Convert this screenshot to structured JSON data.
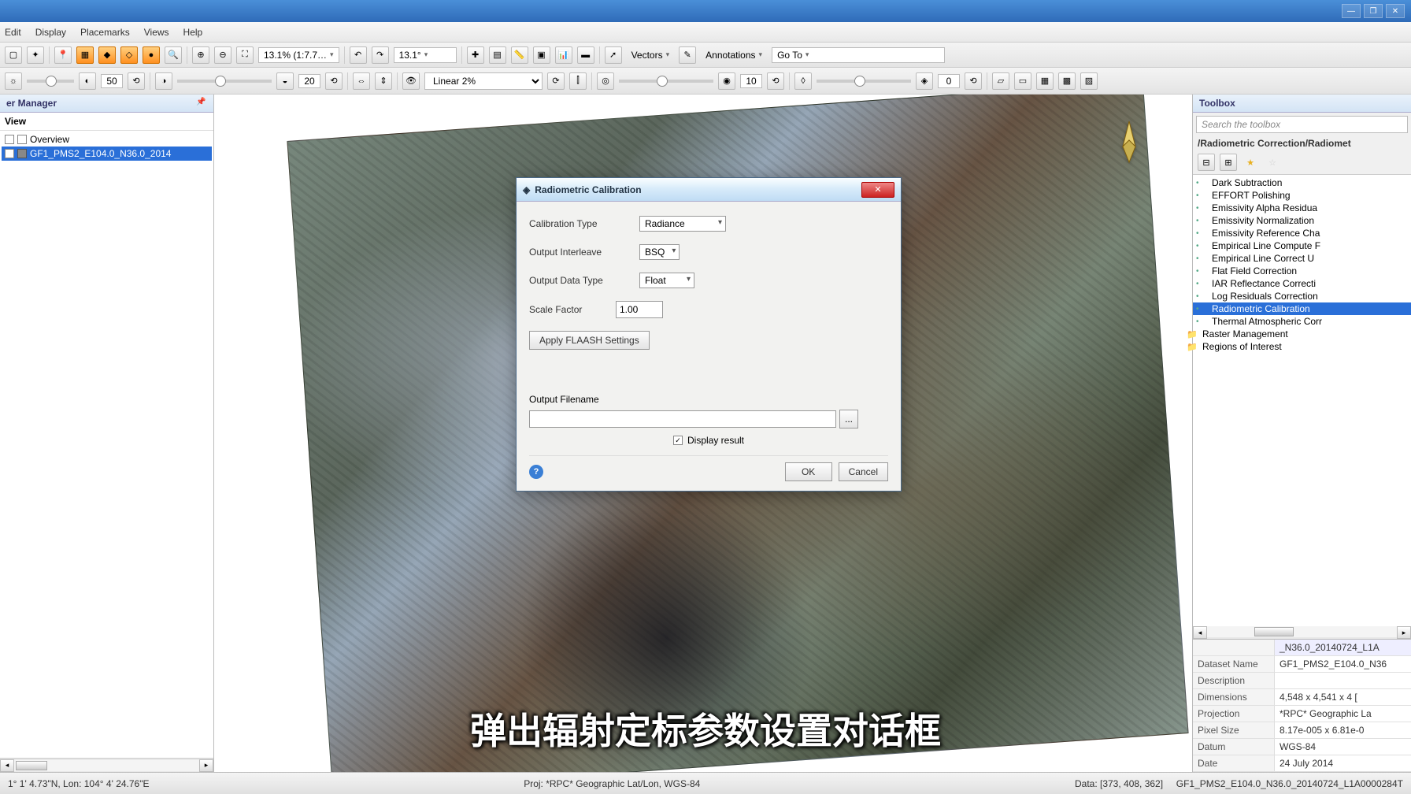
{
  "menubar": [
    "Edit",
    "Display",
    "Placemarks",
    "Views",
    "Help"
  ],
  "toolbar": {
    "zoom_text": "13.1% (1:7.7…",
    "rotation": "13.1°",
    "vectors": "Vectors",
    "annotations": "Annotations",
    "goto": "Go To"
  },
  "toolbar2": {
    "val1": "50",
    "val2": "20",
    "stretch": "Linear 2%",
    "val3": "10",
    "val4": "0"
  },
  "left_panel": {
    "title": "er Manager",
    "view_label": "View",
    "overview": "Overview",
    "layer_selected": "GF1_PMS2_E104.0_N36.0_2014"
  },
  "right_panel": {
    "title": "Toolbox",
    "search_placeholder": "Search the toolbox",
    "breadcrumb": "/Radiometric Correction/Radiomet",
    "tree": [
      {
        "label": "Dark Subtraction",
        "sel": false
      },
      {
        "label": "EFFORT Polishing",
        "sel": false
      },
      {
        "label": "Emissivity Alpha Residua",
        "sel": false
      },
      {
        "label": "Emissivity Normalization",
        "sel": false
      },
      {
        "label": "Emissivity Reference Cha",
        "sel": false
      },
      {
        "label": "Empirical Line Compute F",
        "sel": false
      },
      {
        "label": "Empirical Line Correct U",
        "sel": false
      },
      {
        "label": "Flat Field Correction",
        "sel": false
      },
      {
        "label": "IAR Reflectance Correcti",
        "sel": false
      },
      {
        "label": "Log Residuals Correction",
        "sel": false
      },
      {
        "label": "Radiometric Calibration",
        "sel": true
      },
      {
        "label": "Thermal Atmospheric Corr",
        "sel": false
      }
    ],
    "folders": [
      "Raster Management",
      "Regions of Interest"
    ],
    "meta_header": "_N36.0_20140724_L1A",
    "meta": [
      {
        "k": "Dataset Name",
        "v": "GF1_PMS2_E104.0_N36"
      },
      {
        "k": "Description",
        "v": ""
      },
      {
        "k": "Dimensions",
        "v": "4,548 x 4,541 x 4 ["
      },
      {
        "k": "Projection",
        "v": "*RPC* Geographic La"
      },
      {
        "k": "Pixel Size",
        "v": "8.17e-005 x 6.81e-0"
      },
      {
        "k": "Datum",
        "v": "WGS-84"
      },
      {
        "k": "Date",
        "v": "24 July 2014"
      }
    ]
  },
  "dialog": {
    "title": "Radiometric Calibration",
    "calibration_type_label": "Calibration Type",
    "calibration_type_value": "Radiance",
    "output_interleave_label": "Output Interleave",
    "output_interleave_value": "BSQ",
    "output_data_type_label": "Output Data Type",
    "output_data_type_value": "Float",
    "scale_factor_label": "Scale Factor",
    "scale_factor_value": "1.00",
    "apply_flaash_btn": "Apply FLAASH Settings",
    "output_filename_label": "Output Filename",
    "output_filename_value": "",
    "browse_btn": "...",
    "display_result_label": "Display result",
    "ok_btn": "OK",
    "cancel_btn": "Cancel"
  },
  "statusbar": {
    "coords": "1° 1' 4.73\"N, Lon: 104° 4' 24.76\"E",
    "projection": "Proj: *RPC* Geographic Lat/Lon, WGS-84",
    "data": "Data: [373, 408, 362]",
    "file": "GF1_PMS2_E104.0_N36.0_20140724_L1A0000284T"
  },
  "subtitle": "弹出辐射定标参数设置对话框"
}
